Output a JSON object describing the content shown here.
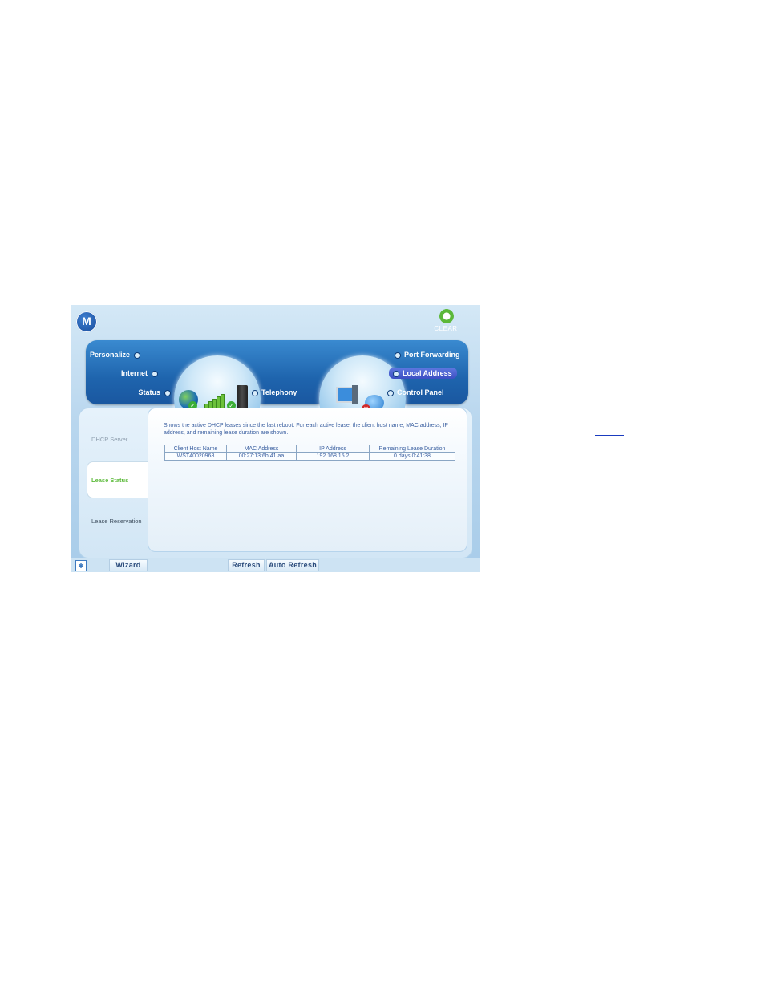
{
  "app": {
    "logo_letter": "M",
    "brand_logo_text": "CLEAR"
  },
  "nav": {
    "left": [
      "Personalize",
      "Internet",
      "Status"
    ],
    "center": "Telephony",
    "right": [
      "Port Forwarding",
      "Local Address",
      "Control Panel"
    ],
    "active": "Local Address"
  },
  "sub_nav": {
    "items": [
      "DHCP Server",
      "Lease Status",
      "Lease Reservation"
    ],
    "active": "Lease Status"
  },
  "content": {
    "description": "Shows the active DHCP leases since the last reboot. For each active lease, the client host name, MAC address, IP address, and remaining lease duration are shown.",
    "table": {
      "headers": [
        "Client Host Name",
        "MAC Address",
        "IP Address",
        "Remaining Lease Duration"
      ],
      "rows": [
        [
          "WST40020968",
          "00:27:13:6b:41:aa",
          "192.168.15.2",
          "0 days 0:41:38"
        ]
      ]
    }
  },
  "bottom_bar": {
    "wizard": "Wizard",
    "refresh": "Refresh",
    "auto_refresh": "Auto Refresh"
  },
  "colors": {
    "nav_band": "#1e64ad",
    "active_nav": "#3c4fc3",
    "active_sub": "#5cba3a",
    "text_blue": "#3a5fa0"
  }
}
